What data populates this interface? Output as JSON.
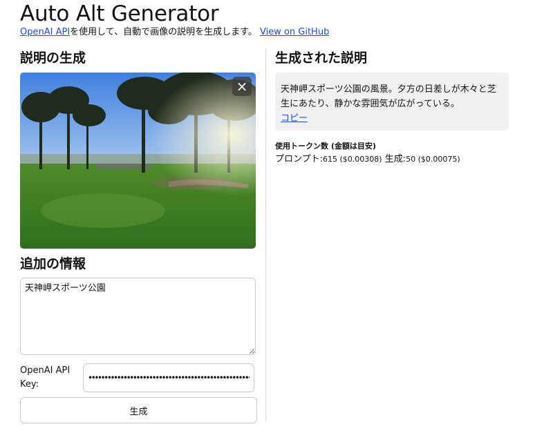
{
  "header": {
    "title": "Auto Alt Generator",
    "openai_link": "OpenAI API",
    "subtitle_text": "を使用して、自動で画像の説明を生成します。",
    "github_link": "View on GitHub"
  },
  "left": {
    "generate_heading": "説明の生成",
    "close_icon": "×",
    "extra_heading": "追加の情報",
    "extra_value": "天神岬スポーツ公園",
    "api_label": "OpenAI API Key:",
    "api_value": "••••••••••••••••••••••••••••••••••••••••••••••••••••••",
    "generate_button": "生成"
  },
  "right": {
    "result_heading": "生成された説明",
    "result_text": "天神岬スポーツ公園の風景。夕方の日差しが木々と芝生にあたり、静かな雰囲気が広がっている。",
    "copy_link": "コピー",
    "tokens_heading": "使用トークン数 (金額は目安)",
    "prompt_label": "プロンプト:",
    "prompt_value": "615 ($0.00308)",
    "gen_label": "生成:",
    "gen_value": "50 ($0.00075)"
  },
  "colors": {
    "link": "#1a4fd6",
    "result_bg": "#f1f1f3",
    "border": "#c9c9c9"
  },
  "icons": [
    "close-icon",
    "resize-grip-icon"
  ]
}
